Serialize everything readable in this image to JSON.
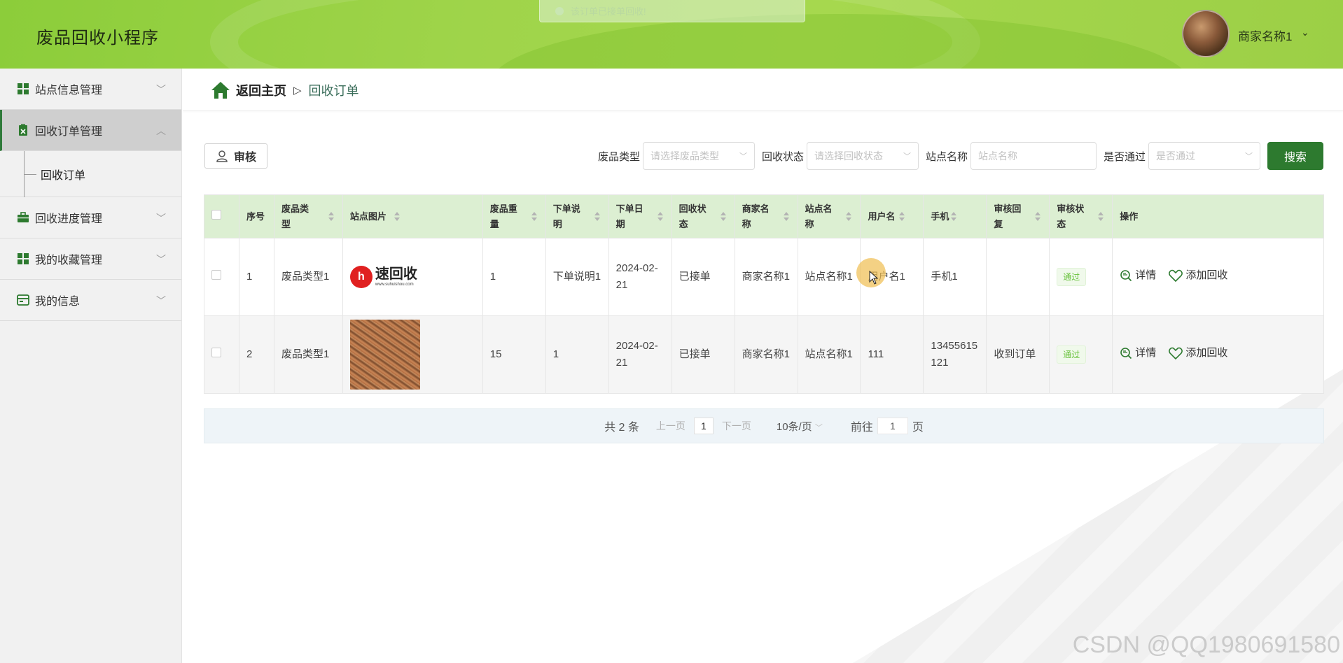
{
  "header": {
    "app_title": "废品回收小程序",
    "toast": "该订单已接单回收!",
    "user_name": "商家名称1"
  },
  "sidebar": {
    "items": [
      {
        "label": "站点信息管理",
        "icon": "grid-icon"
      },
      {
        "label": "回收订单管理",
        "icon": "clipboard-icon",
        "active": true
      },
      {
        "label": "回收进度管理",
        "icon": "briefcase-icon"
      },
      {
        "label": "我的收藏管理",
        "icon": "grid-icon"
      },
      {
        "label": "我的信息",
        "icon": "card-icon"
      }
    ],
    "sub_item": "回收订单"
  },
  "breadcrumb": {
    "home": "返回主页",
    "separator": "▷",
    "current": "回收订单"
  },
  "toolbar": {
    "audit_label": "审核",
    "filters": {
      "type_label": "废品类型",
      "type_placeholder": "请选择废品类型",
      "status_label": "回收状态",
      "status_placeholder": "请选择回收状态",
      "station_label": "站点名称",
      "station_placeholder": "站点名称",
      "pass_label": "是否通过",
      "pass_placeholder": "是否通过"
    },
    "search_label": "搜索"
  },
  "table": {
    "columns": [
      "序号",
      "废品类型",
      "站点图片",
      "废品重量",
      "下单说明",
      "下单日期",
      "回收状态",
      "商家名称",
      "站点名称",
      "用户名",
      "手机",
      "审核回复",
      "审核状态",
      "操作"
    ],
    "rows": [
      {
        "no": "1",
        "type": "废品类型1",
        "weight": "1",
        "note": "下单说明1",
        "date": "2024-02-21",
        "status": "已接单",
        "merchant": "商家名称1",
        "station": "站点名称1",
        "user": "用户名1",
        "phone": "手机1",
        "reply": "",
        "audit": "通过",
        "logo_mark": "h",
        "logo_text": "速回收",
        "logo_url": "www.suhuishou.com"
      },
      {
        "no": "2",
        "type": "废品类型1",
        "weight": "15",
        "note": "1",
        "date": "2024-02-21",
        "status": "已接单",
        "merchant": "商家名称1",
        "station": "站点名称1",
        "user": "111",
        "phone": "13455615121",
        "reply": "收到订单",
        "audit": "通过"
      }
    ],
    "actions": {
      "detail": "详情",
      "add": "添加回收"
    }
  },
  "pager": {
    "total": "共 2 条",
    "prev": "上一页",
    "page": "1",
    "next": "下一页",
    "size": "10条/页",
    "goto_prefix": "前往",
    "goto_value": "1",
    "goto_suffix": "页"
  },
  "watermark": "CSDN @QQ1980691580",
  "colors": {
    "primary": "#2d7a2f",
    "header": "#9fd44a",
    "table_head": "#dcefd2",
    "success": "#67c23a"
  }
}
